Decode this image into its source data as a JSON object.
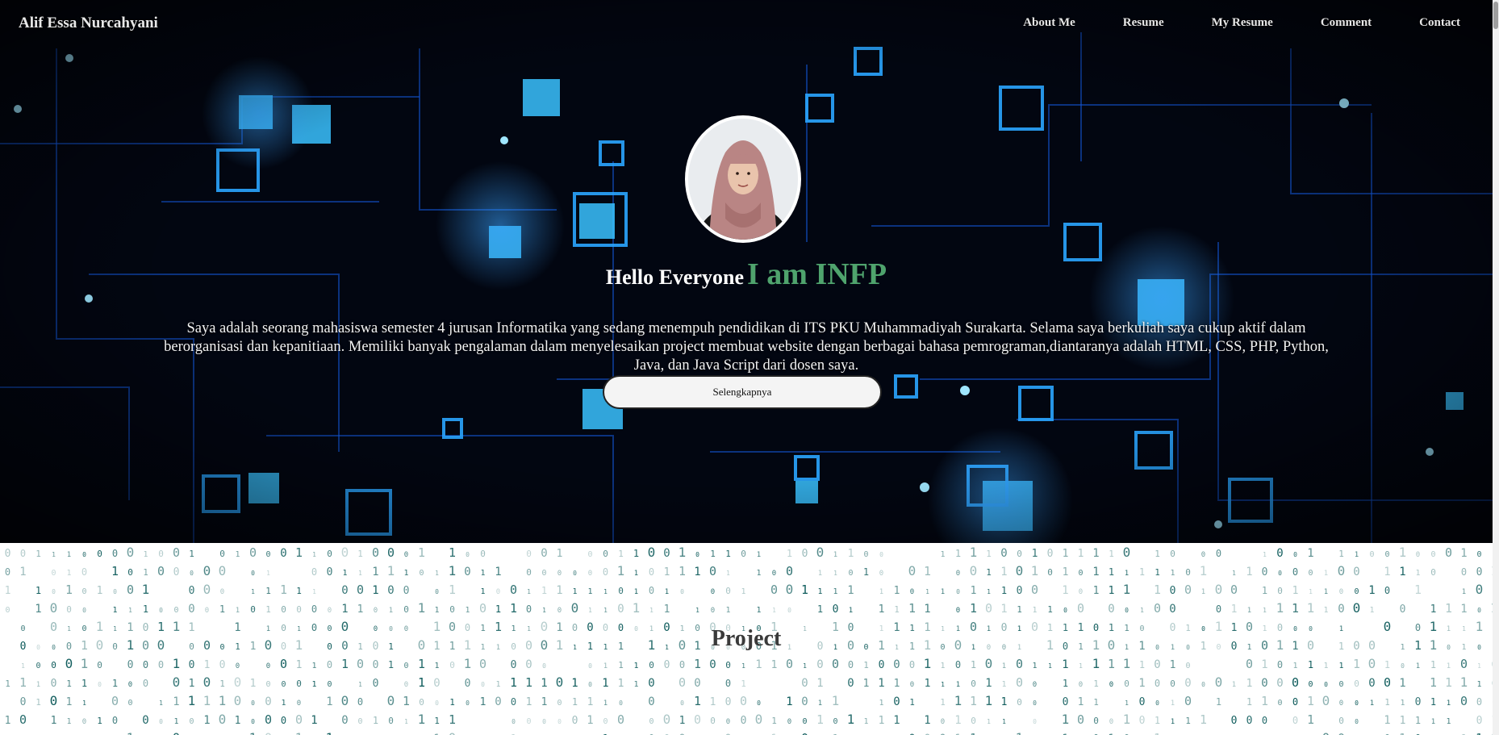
{
  "nav": {
    "brand": "Alif Essa Nurcahyani",
    "items": [
      "About Me",
      "Resume",
      "My Resume",
      "Comment",
      "Contact"
    ]
  },
  "hero": {
    "greeting": "Hello Everyone",
    "highlight": "I am INFP",
    "about": "Saya adalah seorang mahasiswa semester 4 jurusan Informatika yang sedang menempuh pendidikan di ITS PKU Muhammadiyah Surakarta. Selama saya berkuliah saya cukup aktif dalam berorganisasi dan kepanitiaan. Memiliki banyak pengalaman dalam menyelesaikan project membuat website dengan berbagai bahasa pemrograman,diantaranya adalah HTML, CSS, PHP, Python, Java, dan Java Script dari dosen saya.",
    "button": "Selengkapnya",
    "avatar_alt": "profile-photo"
  },
  "project": {
    "title": "Project"
  },
  "colors": {
    "hero_bg": "#01040d",
    "accent": "#4fa36d",
    "circuit": "#1f6cff",
    "binary": "#0c5a5a"
  }
}
